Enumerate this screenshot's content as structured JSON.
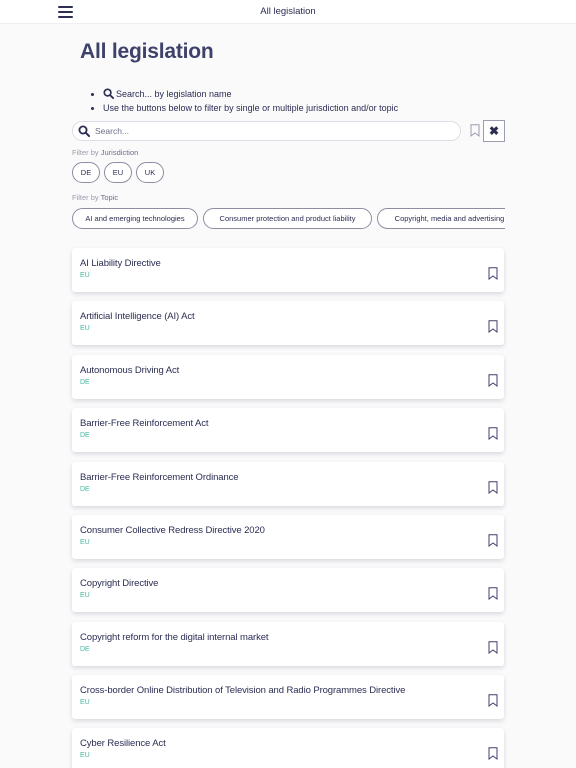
{
  "header": {
    "title": "All legislation",
    "menu_icon": "hamburger-icon"
  },
  "page": {
    "title": "All legislation"
  },
  "hints": {
    "search": "Search... by legislation name",
    "filter": "Use the buttons below to filter by single or multiple jurisdiction and/or topic"
  },
  "search": {
    "placeholder": "Search...",
    "value": ""
  },
  "filters": {
    "jurisdiction_prefix": "Filter by",
    "jurisdiction_label": "Jurisdiction",
    "jurisdictions": [
      "DE",
      "EU",
      "UK"
    ],
    "topic_prefix": "Filter by",
    "topic_label": "Topic",
    "topics": [
      "AI and emerging technologies",
      "Consumer protection and product liability",
      "Copyright, media and advertising"
    ]
  },
  "clear_button": {
    "label": "✖"
  },
  "legislation": [
    {
      "title": "AI Liability Directive",
      "jurisdiction": "EU"
    },
    {
      "title": "Artificial Intelligence (AI) Act",
      "jurisdiction": "EU"
    },
    {
      "title": "Autonomous Driving Act",
      "jurisdiction": "DE"
    },
    {
      "title": "Barrier-Free Reinforcement Act",
      "jurisdiction": "DE"
    },
    {
      "title": "Barrier-Free Reinforcement Ordinance",
      "jurisdiction": "DE"
    },
    {
      "title": "Consumer Collective Redress Directive 2020",
      "jurisdiction": "EU"
    },
    {
      "title": "Copyright Directive",
      "jurisdiction": "EU"
    },
    {
      "title": "Copyright reform for the digital internal market",
      "jurisdiction": "DE"
    },
    {
      "title": "Cross-border Online Distribution of Television and Radio Programmes Directive",
      "jurisdiction": "EU"
    },
    {
      "title": "Cyber Resilience Act",
      "jurisdiction": "EU"
    }
  ],
  "colors": {
    "primary": "#2b2d52",
    "heading": "#3f416b",
    "accent": "#43b9a1",
    "muted": "#9a9cae"
  }
}
